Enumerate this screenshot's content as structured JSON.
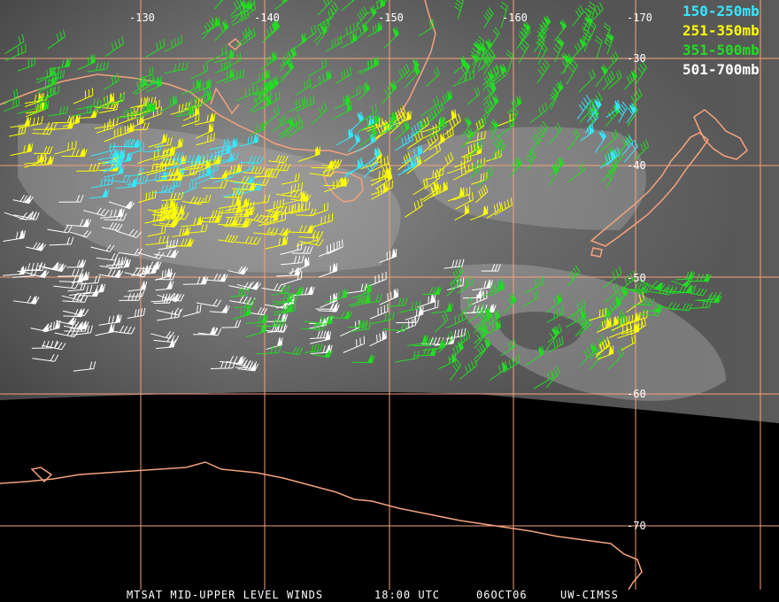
{
  "colors": {
    "grid": "#f4a27c",
    "coast": "#f4a27c",
    "c150_250": "#35e7ff",
    "c251_350": "#ffff00",
    "c351_500": "#22dd22",
    "c501_700": "#ffffff",
    "cloud_dark": "#2b2b2b",
    "cloud_light": "#a8a8a8"
  },
  "longitude_labels": [
    "-130",
    "-140",
    "-150",
    "-160",
    "-170"
  ],
  "latitude_labels": [
    "-30",
    "-40",
    "-50",
    "-60",
    "-70"
  ],
  "legend": [
    {
      "label": "150-250mb",
      "color_key": "c150_250"
    },
    {
      "label": "251-350mb",
      "color_key": "c251_350"
    },
    {
      "label": "351-500mb",
      "color_key": "c351_500"
    },
    {
      "label": "501-700mb",
      "color_key": "c501_700"
    }
  ],
  "footer": {
    "product": "MTSAT MID-UPPER LEVEL WINDS",
    "time": "18:00 UTC",
    "date": "06OCT06",
    "source": "UW-CIMSS"
  }
}
